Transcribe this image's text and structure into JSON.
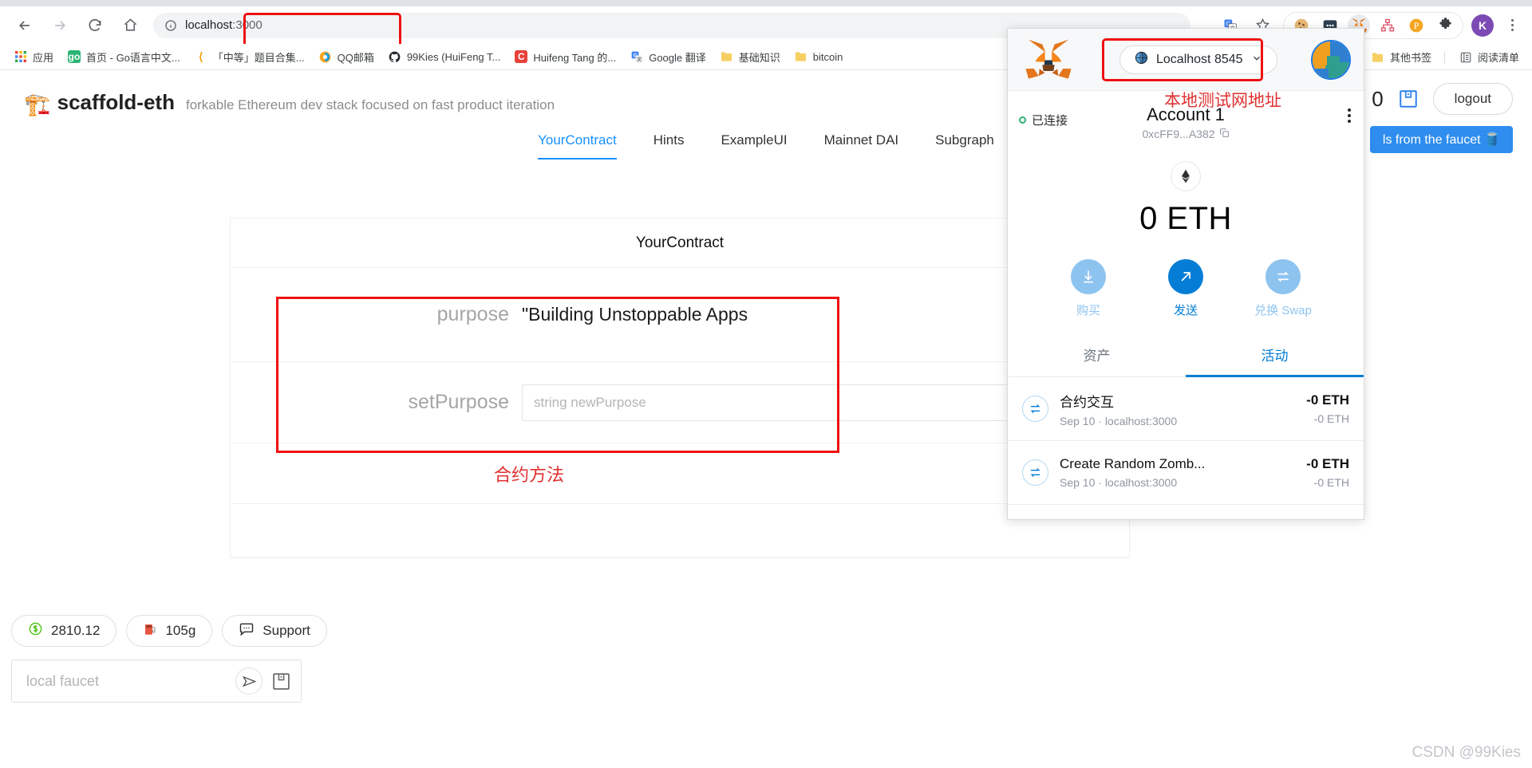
{
  "browser": {
    "url_host": "localhost",
    "url_port": ":3000",
    "nav": {
      "back": "back-arrow",
      "forward": "forward-arrow",
      "reload": "reload-arrow",
      "home": "home-house"
    },
    "toolbar_icons": [
      {
        "name": "translate-icon",
        "glyph": "G"
      },
      {
        "name": "bookmark-star-icon",
        "glyph": "☆"
      }
    ],
    "extensions": [
      {
        "name": "cookie-extension-icon",
        "glyph": "🍪"
      },
      {
        "name": "dotted-extension-icon",
        "glyph": "•••"
      },
      {
        "name": "metamask-extension-icon",
        "glyph": "🦊"
      },
      {
        "name": "sitemap-extension-icon",
        "glyph": "⛒"
      },
      {
        "name": "pinterest-extension-icon",
        "glyph": "P"
      },
      {
        "name": "puzzle-extensions-icon",
        "glyph": "🧩"
      }
    ],
    "profile_initial": "K",
    "bookmarks": [
      {
        "label": "应用",
        "icon": "apps-grid-icon",
        "color": "#4285f4"
      },
      {
        "label": "首页 - Go语言中文...",
        "icon": "go-icon",
        "color": "#29b473"
      },
      {
        "label": "「中等」题目合集...",
        "icon": "leetcode-icon",
        "color": "#f0f0f0"
      },
      {
        "label": "QQ邮箱",
        "icon": "qq-mail-icon",
        "color": "#f5a623"
      },
      {
        "label": "99Kies (HuiFeng T...",
        "icon": "github-icon",
        "color": "#24292e"
      },
      {
        "label": "Huifeng Tang 的...",
        "icon": "csdn-icon",
        "color": "#e8413a"
      },
      {
        "label": "Google 翻译",
        "icon": "google-translate-icon",
        "color": "#4285f4"
      },
      {
        "label": "基础知识",
        "icon": "folder-icon",
        "color": "#f7d064"
      },
      {
        "label": "bitcoin",
        "icon": "folder-icon",
        "color": "#f7d064"
      }
    ],
    "bookmarks_right": [
      {
        "label": "其他书签",
        "icon": "folder-icon"
      },
      {
        "label": "阅读清单",
        "icon": "reading-list-icon"
      }
    ]
  },
  "site": {
    "logo_icon": "construction-crane-icon",
    "name": "scaffold-eth",
    "tagline": "forkable Ethereum dev stack focused on fast product iteration",
    "header_balance": "0",
    "wallet_icon": "wallet-icon",
    "logout_label": "logout",
    "faucet_banner": "ls from the faucet 🛢️",
    "tabs": [
      {
        "label": "YourContract",
        "active": true
      },
      {
        "label": "Hints",
        "active": false
      },
      {
        "label": "ExampleUI",
        "active": false
      },
      {
        "label": "Mainnet DAI",
        "active": false
      },
      {
        "label": "Subgraph",
        "active": false
      }
    ]
  },
  "contract": {
    "title": "YourContract",
    "blockie_icon": "blockie-avatar",
    "rows": [
      {
        "label": "purpose",
        "value": "\"Building Unstoppable Apps"
      },
      {
        "label": "setPurpose",
        "placeholder": "string newPurpose"
      }
    ],
    "annotation_cn": "合约方法"
  },
  "bottom_left": {
    "chips": [
      {
        "icon": "dollar-circle-icon",
        "label": "2810.12"
      },
      {
        "icon": "gas-pump-icon",
        "label": "105g"
      },
      {
        "icon": "chat-bubble-icon",
        "label": "Support"
      }
    ],
    "faucet_placeholder": "local faucet",
    "send_icon": "send-paper-plane-icon",
    "wallet_icon": "wallet-icon"
  },
  "watermark": "CSDN @99Kies",
  "metamask": {
    "fox_icon": "metamask-fox-icon",
    "network": {
      "label": "Localhost 8545",
      "globe_icon": "globe-icon",
      "chevron_icon": "chevron-down-icon"
    },
    "network_note_cn": "本地测试网地址",
    "account_avatar_icon": "account-identicon",
    "connected_label": "已连接",
    "account_name": "Account 1",
    "account_address": "0xcFF9...A382",
    "copy_icon": "copy-icon",
    "menu_icon": "kebab-menu-icon",
    "token_icon": "ethereum-diamond-icon",
    "balance": "0 ETH",
    "actions": [
      {
        "icon": "download-arrow-icon",
        "label": "购买",
        "style": "light"
      },
      {
        "icon": "send-arrow-icon",
        "label": "发送",
        "style": "solid"
      },
      {
        "icon": "swap-arrows-icon",
        "label": "兑换 Swap",
        "style": "light"
      }
    ],
    "tabs": [
      {
        "label": "资产",
        "active": false
      },
      {
        "label": "活动",
        "active": true
      }
    ],
    "transactions": [
      {
        "icon": "contract-interaction-icon",
        "title": "合约交互",
        "sub": "Sep 10 · localhost:3000",
        "amount": "-0 ETH",
        "amount2": "-0 ETH"
      },
      {
        "icon": "contract-interaction-icon",
        "title": "Create Random Zomb...",
        "sub": "Sep 10 · localhost:3000",
        "amount": "-0 ETH",
        "amount2": "-0 ETH"
      }
    ]
  },
  "colors": {
    "annotation_red": "#ee1111",
    "accent_blue": "#1890ff",
    "metamask_blue": "#037dd6"
  }
}
